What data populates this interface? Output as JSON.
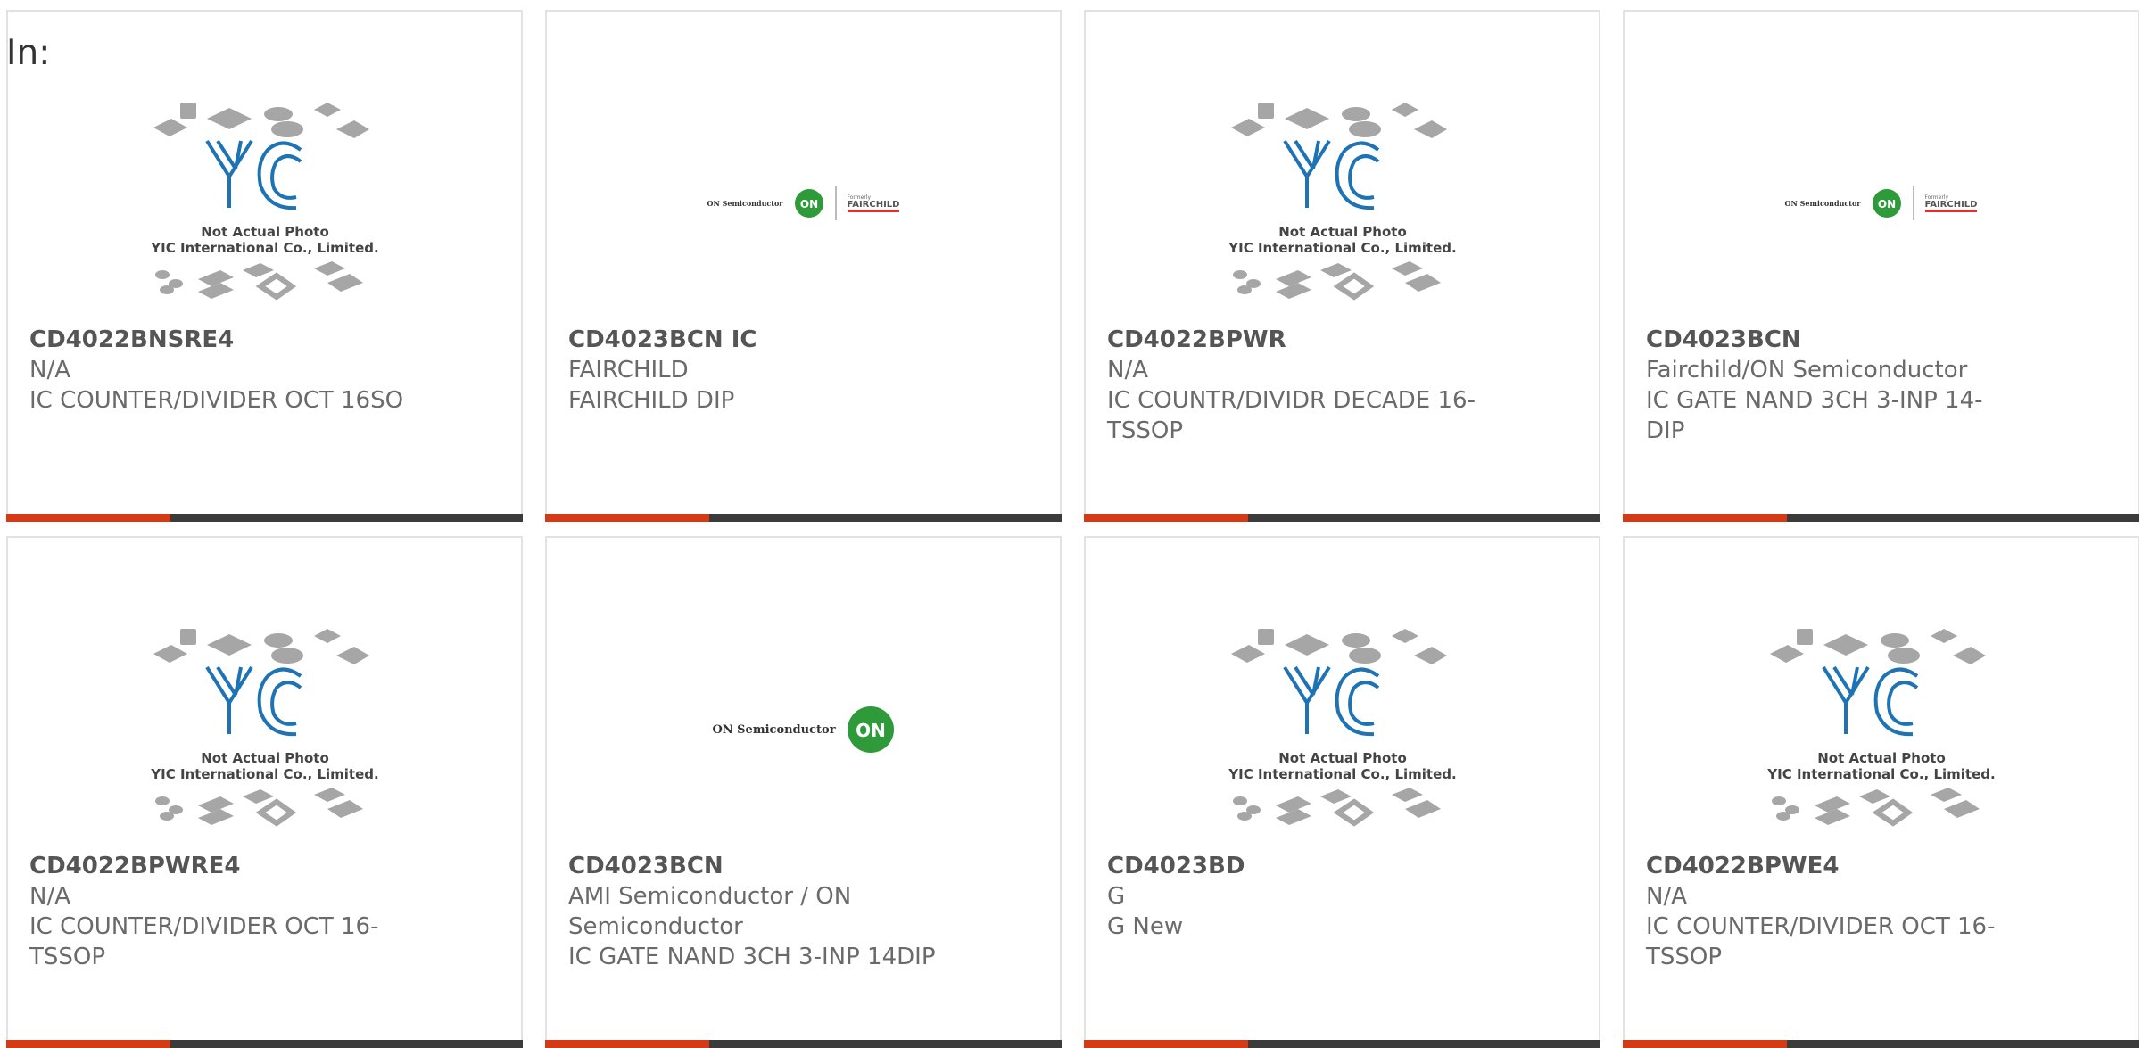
{
  "page": {
    "filter_label": "In:"
  },
  "colors": {
    "accent": "#d53a15",
    "bar": "#3b3b3b",
    "yic_blue": "#1e73b5",
    "on_green": "#2e9a3a",
    "fairchild_red": "#e2332b"
  },
  "yic_placeholder": {
    "line1": "Not Actual Photo",
    "line2": "YIC International Co., Limited."
  },
  "logos": {
    "on_semiconductor": "ON Semiconductor",
    "on_mark": "ON",
    "formerly": "Formerly",
    "fairchild": "FAIRCHILD"
  },
  "products": [
    {
      "part": "CD4022BNSRE4",
      "maker": "N/A",
      "desc": "IC COUNTER/DIVIDER OCT 16SO",
      "image": "yic-placeholder"
    },
    {
      "part": "CD4023BCN IC",
      "maker": "FAIRCHILD",
      "desc": "FAIRCHILD DIP",
      "image": "on-fairchild-logo"
    },
    {
      "part": "CD4022BPWR",
      "maker": "N/A",
      "desc": "IC COUNTR/DIVIDR DECADE 16-TSSOP",
      "image": "yic-placeholder"
    },
    {
      "part": "CD4023BCN",
      "maker": "Fairchild/ON Semiconductor",
      "desc": "IC GATE NAND 3CH 3-INP 14-DIP",
      "image": "on-fairchild-logo"
    },
    {
      "part": "CD4022BPWRE4",
      "maker": "N/A",
      "desc": "IC COUNTER/DIVIDER OCT 16-TSSOP",
      "image": "yic-placeholder"
    },
    {
      "part": "CD4023BCN",
      "maker": "AMI Semiconductor / ON Semiconductor",
      "desc": "IC GATE NAND 3CH 3-INP 14DIP",
      "image": "on-semiconductor-logo"
    },
    {
      "part": "CD4023BD",
      "maker": "G",
      "desc": "G New",
      "image": "yic-placeholder"
    },
    {
      "part": "CD4022BPWE4",
      "maker": "N/A",
      "desc": "IC COUNTER/DIVIDER OCT 16-TSSOP",
      "image": "yic-placeholder"
    }
  ]
}
